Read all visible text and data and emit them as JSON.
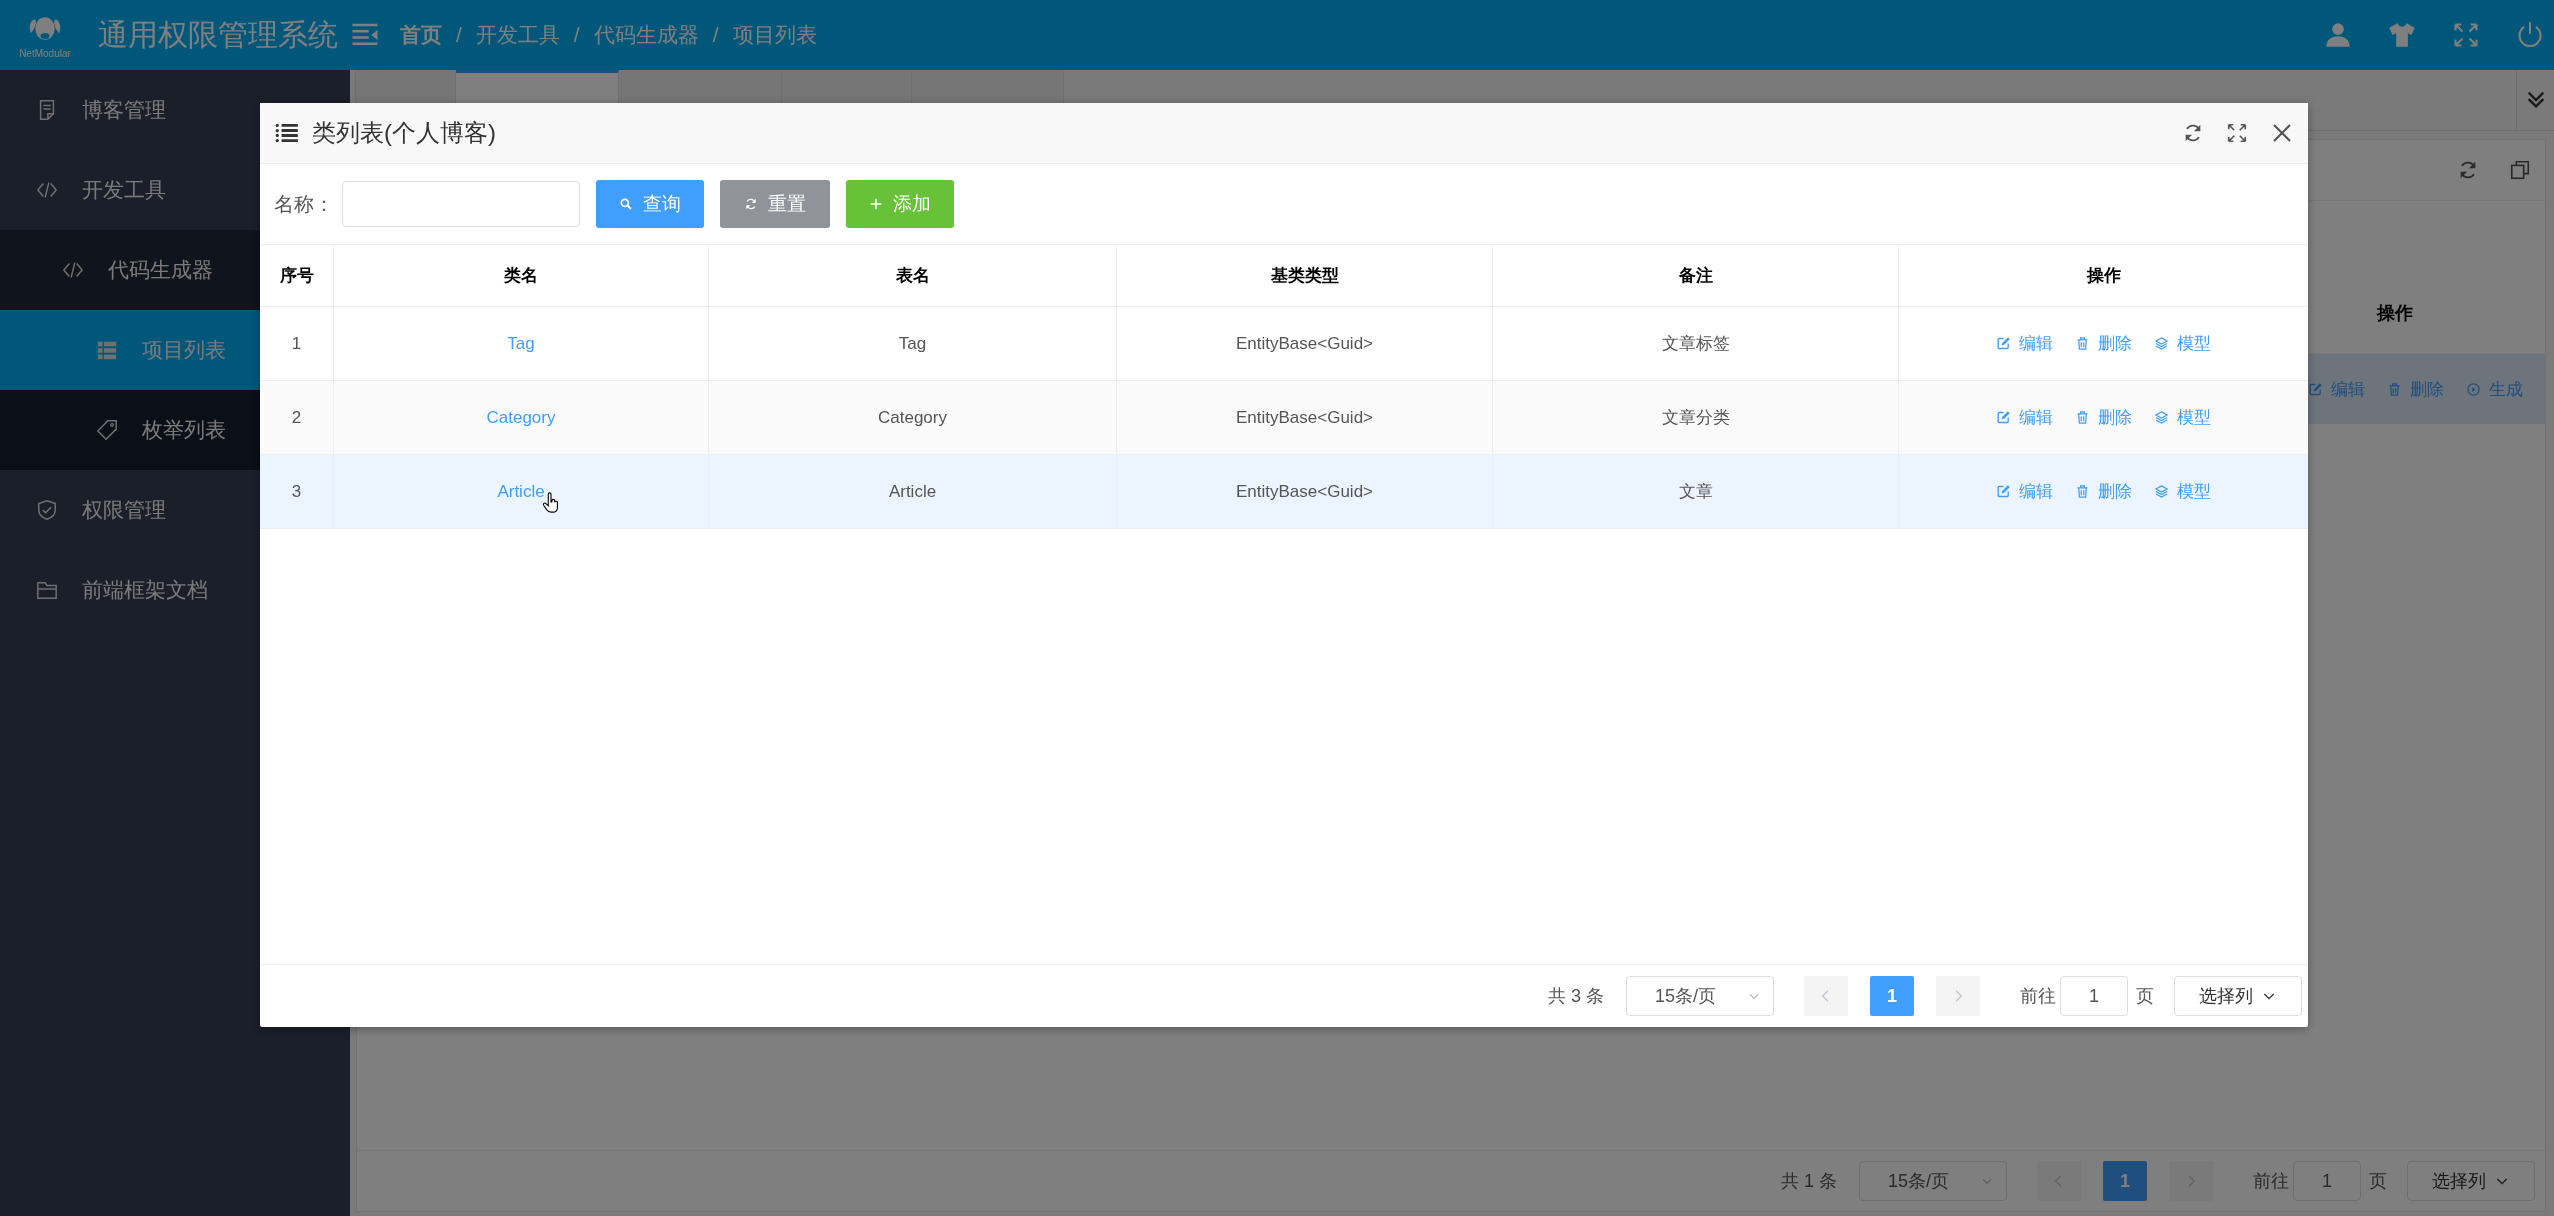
{
  "header": {
    "logo_text": "NetModular",
    "title": "通用权限管理系统",
    "breadcrumb": [
      "首页",
      "开发工具",
      "代码生成器",
      "项目列表"
    ],
    "separator": "/"
  },
  "sidebar": {
    "items": [
      {
        "label": "博客管理",
        "selected": false
      },
      {
        "label": "开发工具",
        "selected": false,
        "children": [
          {
            "label": "代码生成器",
            "selected": false,
            "children": [
              {
                "label": "项目列表",
                "selected": true
              },
              {
                "label": "枚举列表",
                "selected": false
              }
            ]
          }
        ]
      },
      {
        "label": "权限管理",
        "selected": false
      },
      {
        "label": "前端框架文档",
        "selected": false
      }
    ]
  },
  "tabs": [
    {
      "selected": false
    },
    {
      "selected": true
    },
    {
      "selected": false
    },
    {
      "selected": false
    },
    {
      "selected": false
    }
  ],
  "page": {
    "table": {
      "columns": [
        "操作"
      ],
      "rows": [
        {
          "highlighted": true,
          "actions": [
            {
              "label": "编辑",
              "kind": "edit"
            },
            {
              "label": "删除",
              "kind": "delete"
            },
            {
              "label": "生成",
              "kind": "generate"
            }
          ]
        }
      ]
    },
    "pagination": {
      "total": "共 1 条",
      "page_size": "15条/页",
      "pages": [
        {
          "label": "1",
          "selected": true
        }
      ],
      "prev_disabled": true,
      "next_disabled": true,
      "goto_label": "前往",
      "goto_value": "1",
      "goto_suffix": "页",
      "columns_button": "选择列"
    }
  },
  "dialog": {
    "title": "类列表(个人博客)",
    "search": {
      "label": "名称："
    },
    "buttons": [
      {
        "label": "查询",
        "kind": "primary"
      },
      {
        "label": "重置",
        "kind": "default"
      },
      {
        "label": "添加",
        "kind": "success"
      }
    ],
    "table": {
      "columns": [
        "序号",
        "类名",
        "表名",
        "基类类型",
        "备注",
        "操作"
      ],
      "rows": [
        {
          "highlighted": false,
          "cells": [
            "1",
            "Tag",
            "Tag",
            "EntityBase<Guid>",
            "文章标签"
          ],
          "actions": [
            {
              "label": "编辑",
              "kind": "edit"
            },
            {
              "label": "删除",
              "kind": "delete"
            },
            {
              "label": "模型",
              "kind": "model"
            }
          ]
        },
        {
          "highlighted": false,
          "cells": [
            "2",
            "Category",
            "Category",
            "EntityBase<Guid>",
            "文章分类"
          ],
          "actions": [
            {
              "label": "编辑",
              "kind": "edit"
            },
            {
              "label": "删除",
              "kind": "delete"
            },
            {
              "label": "模型",
              "kind": "model"
            }
          ]
        },
        {
          "highlighted": true,
          "cells": [
            "3",
            "Article",
            "Article",
            "EntityBase<Guid>",
            "文章"
          ],
          "actions": [
            {
              "label": "编辑",
              "kind": "edit"
            },
            {
              "label": "删除",
              "kind": "delete"
            },
            {
              "label": "模型",
              "kind": "model"
            }
          ]
        }
      ]
    },
    "pagination": {
      "total": "共 3 条",
      "page_size": "15条/页",
      "pages": [
        {
          "label": "1",
          "selected": true
        }
      ],
      "prev_disabled": true,
      "next_disabled": true,
      "goto_label": "前往",
      "goto_value": "1",
      "goto_suffix": "页",
      "columns_button": "选择列"
    }
  }
}
